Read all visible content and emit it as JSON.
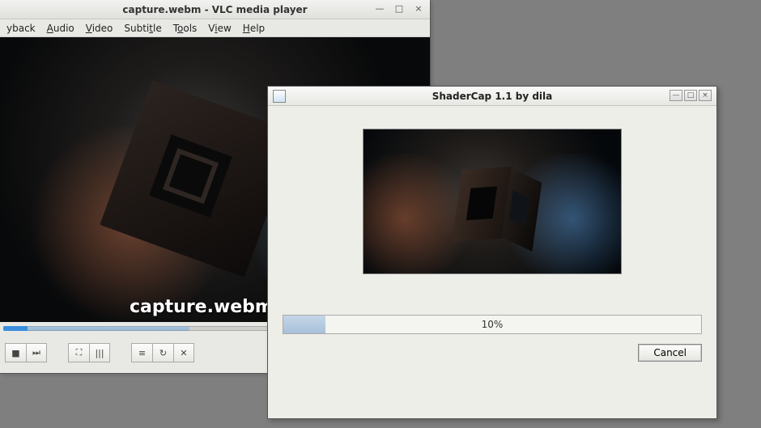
{
  "vlc": {
    "title": "capture.webm - VLC media player",
    "menu": {
      "playback": "yback",
      "audio": "Audio",
      "video": "Video",
      "subtitle": "Subtitle",
      "tools": "Tools",
      "view": "View",
      "help": "Help"
    },
    "overlay_text": "capture.webm",
    "controls": {
      "stop": "■",
      "next": "⏭",
      "fullscreen": "⛶",
      "ext": "⛶",
      "eq": "|||",
      "playlist": "≡",
      "loop": "↻",
      "shuffle": "✕"
    },
    "window_controls": {
      "min": "—",
      "max": "□",
      "close": "×"
    }
  },
  "shadercap": {
    "title": "ShaderCap 1.1 by dila",
    "progress_percent": "10%",
    "progress_fill_css": "width:10%",
    "cancel_label": "Cancel",
    "window_controls": {
      "min": "—",
      "max": "□",
      "close": "×"
    }
  }
}
